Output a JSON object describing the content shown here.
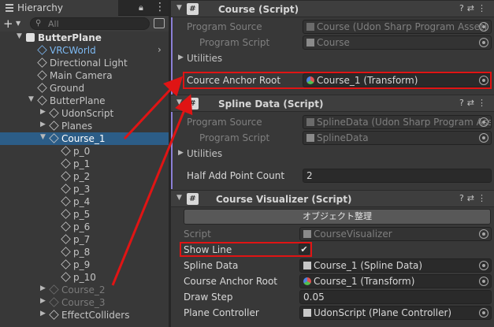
{
  "hierarchy": {
    "tab_label": "Hierarchy",
    "search_placeholder": "All",
    "rows": [
      {
        "label": "ButterPlane",
        "type": "scene",
        "depth": 0,
        "arrow": "▼"
      },
      {
        "label": "VRCWorld",
        "type": "prefab",
        "depth": 1,
        "arrow": ""
      },
      {
        "label": "Directional Light",
        "type": "object",
        "depth": 1,
        "arrow": ""
      },
      {
        "label": "Main Camera",
        "type": "object",
        "depth": 1,
        "arrow": ""
      },
      {
        "label": "Ground",
        "type": "object",
        "depth": 1,
        "arrow": ""
      },
      {
        "label": "ButterPlane",
        "type": "object",
        "depth": 1,
        "arrow": "▼"
      },
      {
        "label": "UdonScript",
        "type": "object",
        "depth": 2,
        "arrow": "▶"
      },
      {
        "label": "Planes",
        "type": "object",
        "depth": 2,
        "arrow": "▶"
      },
      {
        "label": "Course_1",
        "type": "selected",
        "depth": 2,
        "arrow": "▼"
      },
      {
        "label": "p_0",
        "type": "object",
        "depth": 3,
        "arrow": ""
      },
      {
        "label": "p_1",
        "type": "object",
        "depth": 3,
        "arrow": ""
      },
      {
        "label": "p_2",
        "type": "object",
        "depth": 3,
        "arrow": ""
      },
      {
        "label": "p_3",
        "type": "object",
        "depth": 3,
        "arrow": ""
      },
      {
        "label": "p_4",
        "type": "object",
        "depth": 3,
        "arrow": ""
      },
      {
        "label": "p_5",
        "type": "object",
        "depth": 3,
        "arrow": ""
      },
      {
        "label": "p_6",
        "type": "object",
        "depth": 3,
        "arrow": ""
      },
      {
        "label": "p_7",
        "type": "object",
        "depth": 3,
        "arrow": ""
      },
      {
        "label": "p_8",
        "type": "object",
        "depth": 3,
        "arrow": ""
      },
      {
        "label": "p_9",
        "type": "object",
        "depth": 3,
        "arrow": ""
      },
      {
        "label": "p_10",
        "type": "object",
        "depth": 3,
        "arrow": ""
      },
      {
        "label": "Course_2",
        "type": "disabled",
        "depth": 2,
        "arrow": "▶"
      },
      {
        "label": "Course_3",
        "type": "disabled",
        "depth": 2,
        "arrow": "▶"
      },
      {
        "label": "EffectColliders",
        "type": "object",
        "depth": 2,
        "arrow": "▶"
      }
    ]
  },
  "inspector": {
    "course": {
      "title": "Course (Script)",
      "program_source_label": "Program Source",
      "program_source_value": "Course (Udon Sharp Program Asset)",
      "program_script_label": "Program Script",
      "program_script_value": "Course",
      "utilities_label": "Utilities",
      "anchor_label": "Cource Anchor Root",
      "anchor_value": "Course_1 (Transform)"
    },
    "spline": {
      "title": "Spline Data (Script)",
      "program_source_label": "Program Source",
      "program_source_value": "SplineData (Udon Sharp Program Ass",
      "program_script_label": "Program Script",
      "program_script_value": "SplineData",
      "utilities_label": "Utilities",
      "half_add_label": "Half Add Point Count",
      "half_add_value": "2"
    },
    "visualizer": {
      "title": "Course Visualizer (Script)",
      "button_label": "オブジェクト整理",
      "script_label": "Script",
      "script_value": "CourseVisualizer",
      "show_line_label": "Show Line",
      "show_line_checked": "✔",
      "spline_data_label": "Spline Data",
      "spline_data_value": "Course_1 (Spline Data)",
      "anchor_label": "Course Anchor Root",
      "anchor_value": "Course_1 (Transform)",
      "draw_step_label": "Draw Step",
      "draw_step_value": "0.05",
      "plane_controller_label": "Plane Controller",
      "plane_controller_value": "UdonScript (Plane Controller)"
    }
  },
  "colors": {
    "selection": "#2c5d87",
    "highlight_red": "#e01414",
    "prefab_blue": "#7db9f2",
    "accent_purple": "#8b7fd6"
  }
}
